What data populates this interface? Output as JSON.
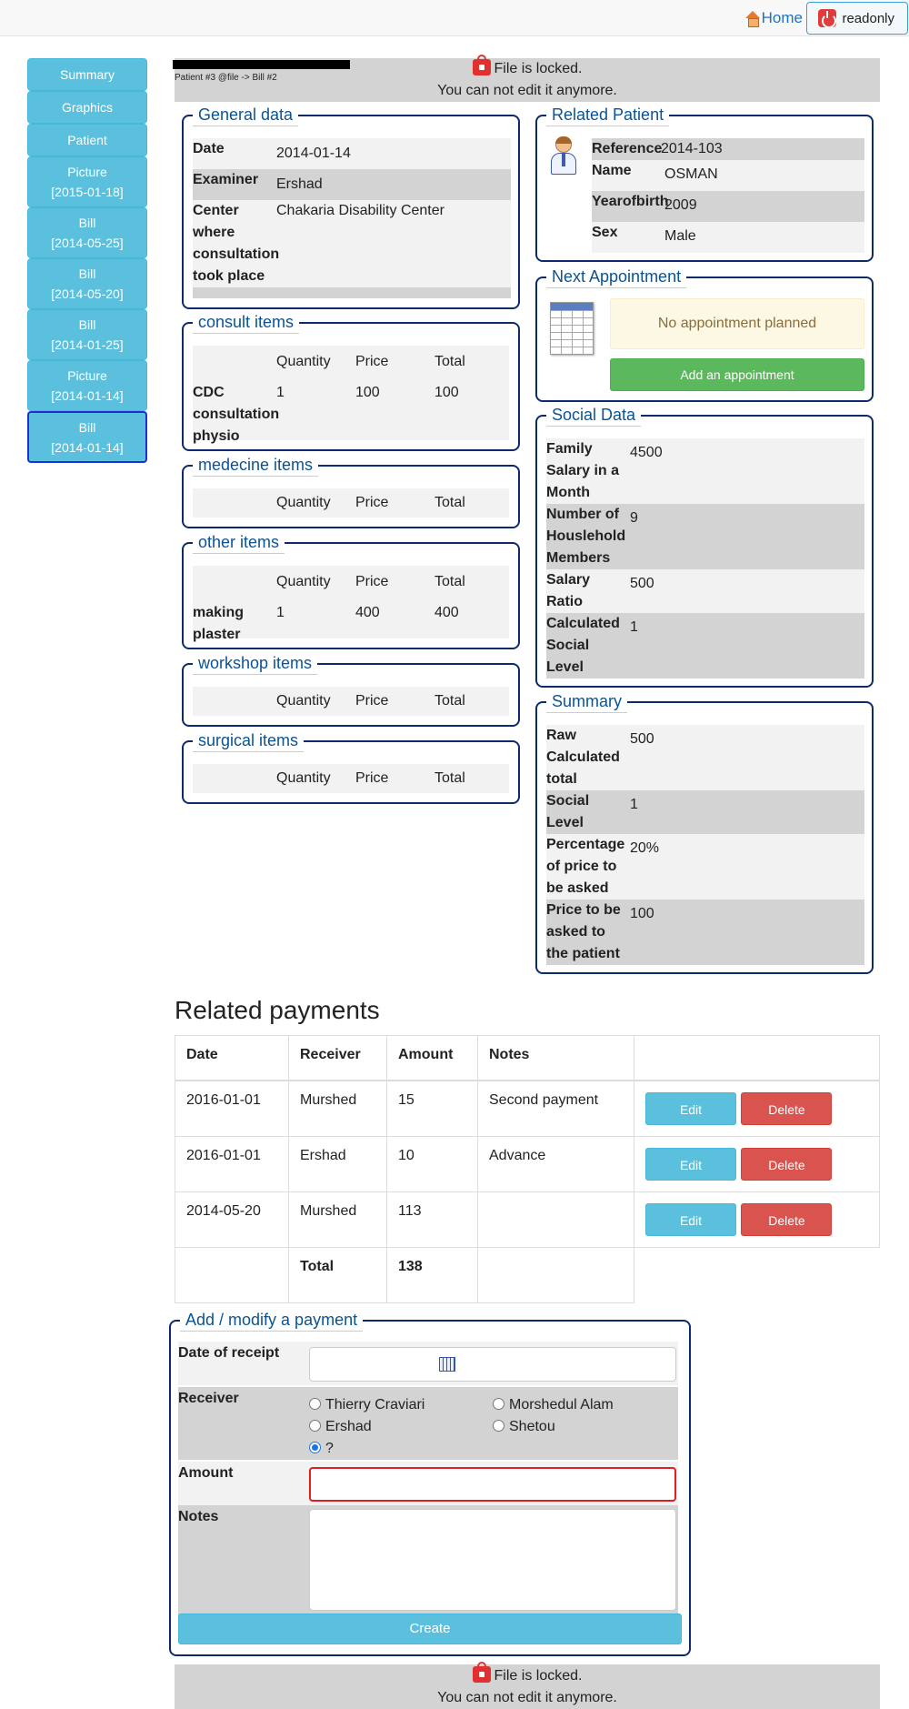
{
  "topbar": {
    "home_label": "Home",
    "readonly_label": "readonly"
  },
  "nav": [
    {
      "line1": "Summary",
      "line2": ""
    },
    {
      "line1": "Graphics",
      "line2": ""
    },
    {
      "line1": "Patient",
      "line2": ""
    },
    {
      "line1": "Picture",
      "line2": "[2015-01-18]"
    },
    {
      "line1": "Bill",
      "line2": "[2014-05-25]"
    },
    {
      "line1": "Bill",
      "line2": "[2014-05-20]"
    },
    {
      "line1": "Bill",
      "line2": "[2014-01-25]"
    },
    {
      "line1": "Picture",
      "line2": "[2014-01-14]"
    },
    {
      "line1": "Bill",
      "line2": "[2014-01-14]"
    }
  ],
  "locked": {
    "line1": "File is locked.",
    "line2": "You can not edit it anymore."
  },
  "crumb": "Patient #3 @file -> Bill #2",
  "general": {
    "title": "General data",
    "date_label": "Date",
    "date_value": "2014-01-14",
    "examiner_label": "Examiner",
    "examiner_value": "Ershad",
    "center_label": "Center where consultation took place",
    "center_value": "Chakaria Disability Center"
  },
  "items_header": {
    "quantity": "Quantity",
    "price": "Price",
    "total": "Total"
  },
  "consult": {
    "title": "consult items",
    "name": "CDC consultation physio",
    "quantity": "1",
    "price": "100",
    "total": "100"
  },
  "medecine": {
    "title": "medecine items"
  },
  "other": {
    "title": "other items",
    "name": "making plaster",
    "quantity": "1",
    "price": "400",
    "total": "400"
  },
  "workshop": {
    "title": "workshop items"
  },
  "surgical": {
    "title": "surgical items"
  },
  "related": {
    "title": "Related Patient",
    "reference_label": "Reference",
    "reference_value": "2014-103",
    "name_label": "Name",
    "name_value": "OSMAN",
    "year_label": "Yearofbirth",
    "year_value": "2009",
    "sex_label": "Sex",
    "sex_value": "Male"
  },
  "appointment": {
    "title": "Next Appointment",
    "none_text": "No appointment planned",
    "add_label": "Add an appointment"
  },
  "social": {
    "title": "Social Data",
    "rows": [
      {
        "label": "Family Salary in a Month",
        "value": "4500"
      },
      {
        "label": "Number of Houslehold Members",
        "value": "9"
      },
      {
        "label": "Salary Ratio",
        "value": "500"
      },
      {
        "label": "Calculated Social Level",
        "value": "1"
      }
    ]
  },
  "summary": {
    "title": "Summary",
    "rows": [
      {
        "label": "Raw Calculated total",
        "value": "500"
      },
      {
        "label": "Social Level",
        "value": "1"
      },
      {
        "label": "Percentage of price to be asked",
        "value": "20%"
      },
      {
        "label": "Price to be asked to the patient",
        "value": "100"
      }
    ]
  },
  "payments": {
    "title": "Related payments",
    "headers": [
      "Date",
      "Receiver",
      "Amount",
      "Notes"
    ],
    "rows": [
      {
        "date": "2016-01-01",
        "receiver": "Murshed",
        "amount": "15",
        "notes": "Second payment"
      },
      {
        "date": "2016-01-01",
        "receiver": "Ershad",
        "amount": "10",
        "notes": "Advance"
      },
      {
        "date": "2014-05-20",
        "receiver": "Murshed",
        "amount": "113",
        "notes": ""
      }
    ],
    "total_label": "Total",
    "total_value": "138",
    "edit_label": "Edit",
    "delete_label": "Delete"
  },
  "form": {
    "title": "Add / modify a payment",
    "date_label": "Date of receipt",
    "receiver_label": "Receiver",
    "receivers": [
      "Thierry Craviari",
      "Morshedul Alam",
      "Ershad",
      "Shetou",
      "?"
    ],
    "selected_receiver": "?",
    "amount_label": "Amount",
    "notes_label": "Notes",
    "create_label": "Create"
  },
  "colors": {
    "nav": "#5bc0de",
    "legend": "#0b5394",
    "border": "#0d2a6b",
    "success": "#5cb85c",
    "danger": "#d9534f"
  }
}
